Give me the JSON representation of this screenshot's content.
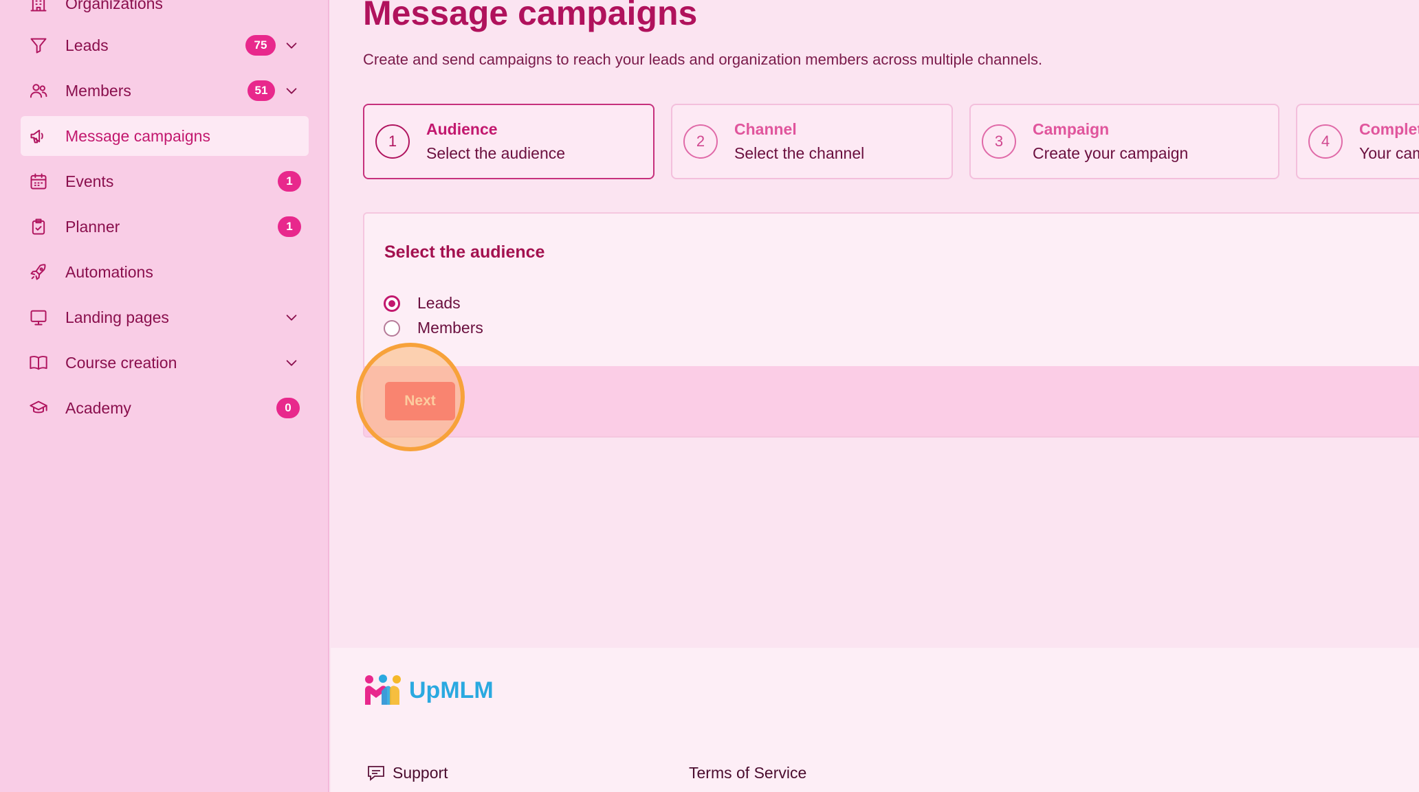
{
  "sidebar": {
    "items": [
      {
        "label": "Organizations",
        "icon": "building-icon"
      },
      {
        "label": "Leads",
        "icon": "funnel-icon",
        "badge": "75"
      },
      {
        "label": "Members",
        "icon": "users-icon",
        "badge": "51"
      },
      {
        "label": "Message campaigns",
        "icon": "megaphone-icon",
        "active": true
      },
      {
        "label": "Events",
        "icon": "calendar-icon",
        "badge": "1"
      },
      {
        "label": "Planner",
        "icon": "clipboard-icon",
        "badge": "1"
      },
      {
        "label": "Automations",
        "icon": "rocket-icon"
      },
      {
        "label": "Landing pages",
        "icon": "monitor-icon"
      },
      {
        "label": "Course creation",
        "icon": "book-icon"
      },
      {
        "label": "Academy",
        "icon": "graduation-cap-icon",
        "badge": "0"
      }
    ]
  },
  "main": {
    "title": "Message campaigns",
    "subtitle": "Create and send campaigns to reach your leads and organization members across multiple channels.",
    "steps": [
      {
        "number": "1",
        "title": "Audience",
        "description": "Select the audience",
        "active": true
      },
      {
        "number": "2",
        "title": "Channel",
        "description": "Select the channel"
      },
      {
        "number": "3",
        "title": "Campaign",
        "description": "Create your campaign"
      },
      {
        "number": "4",
        "title": "Complet",
        "description": "Your cam"
      }
    ],
    "audience": {
      "heading": "Select the audience",
      "options": [
        {
          "label": "Leads",
          "checked": true
        },
        {
          "label": "Members",
          "checked": false
        }
      ],
      "next_label": "Next"
    }
  },
  "footer": {
    "logo_text": "UpMLM",
    "support_label": "Support",
    "terms_label": "Terms of Service"
  },
  "colors": {
    "accent": "#c2186e",
    "badge": "#e8288c",
    "sidebar_bg": "#f9cde6",
    "page_bg": "#fbe4f1",
    "next_button": "#f76482",
    "click_marker": "#f7a23a"
  }
}
